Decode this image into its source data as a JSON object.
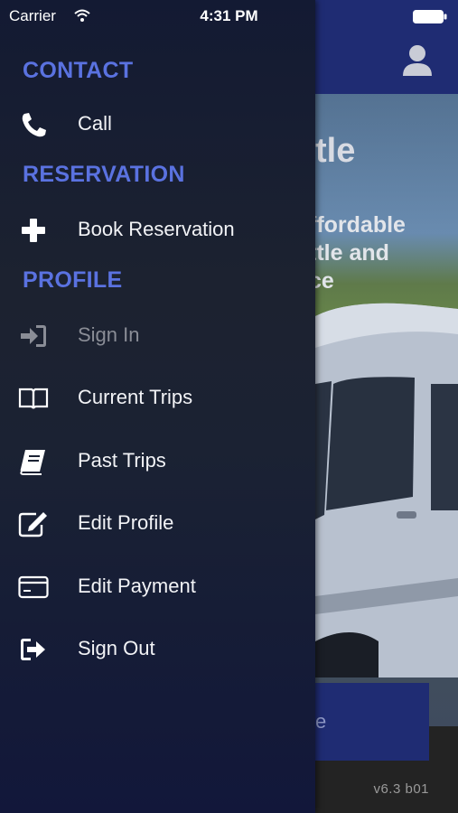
{
  "status_bar": {
    "carrier": "Carrier",
    "time": "4:31 PM"
  },
  "drawer": {
    "sections": [
      {
        "title": "CONTACT"
      },
      {
        "title": "RESERVATION"
      },
      {
        "title": "PROFILE"
      }
    ],
    "items": {
      "call": {
        "label": "Call",
        "icon": "phone-icon"
      },
      "book": {
        "label": "Book Reservation",
        "icon": "plus-icon"
      },
      "sign_in": {
        "label": "Sign In",
        "icon": "sign-in-icon",
        "state": "disabled"
      },
      "current": {
        "label": "Current Trips",
        "icon": "open-book-icon"
      },
      "past": {
        "label": "Past Trips",
        "icon": "book-icon"
      },
      "edit_profile": {
        "label": "Edit Profile",
        "icon": "edit-icon"
      },
      "edit_payment": {
        "label": "Edit Payment",
        "icon": "credit-card-icon"
      },
      "sign_out": {
        "label": "Sign Out",
        "icon": "sign-out-icon"
      }
    }
  },
  "background": {
    "hero_title": "tle",
    "hero_lines": [
      "ffordable",
      "ttle and",
      "ce"
    ],
    "button_label": "e",
    "version": "v6.3  b01"
  },
  "colors": {
    "accent": "#5a72e0",
    "brand_bar": "#1f2c73"
  }
}
